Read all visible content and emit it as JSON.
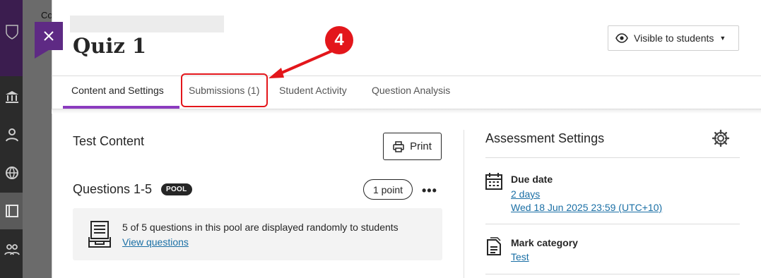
{
  "background_app": {
    "partial_text": "Co"
  },
  "panel": {
    "close_icon": "close-icon",
    "title": "Quiz 1",
    "visibility": {
      "label": "Visible to students",
      "icon": "eye-icon"
    }
  },
  "tabs": [
    {
      "label": "Content and Settings",
      "active": true
    },
    {
      "label": "Submissions (1)",
      "active": false
    },
    {
      "label": "Student Activity",
      "active": false
    },
    {
      "label": "Question Analysis",
      "active": false
    }
  ],
  "annotation": {
    "step_number": "4",
    "color": "#e3161b"
  },
  "test_content": {
    "title": "Test Content",
    "print_label": "Print",
    "questions_title": "Questions 1-5",
    "pool_badge": "POOL",
    "points": "1 point",
    "more_label": "•••",
    "pool_message": "5 of 5 questions in this pool are displayed randomly to students",
    "view_questions_link": "View questions"
  },
  "assessment_settings": {
    "title": "Assessment Settings",
    "due_date": {
      "label": "Due date",
      "relative": "2 days",
      "absolute": "Wed 18 Jun 2025 23:59 (UTC+10)"
    },
    "mark_category": {
      "label": "Mark category",
      "value": "Test"
    }
  },
  "colors": {
    "accent": "#8b3bbf",
    "brand_purple": "#5e2a84",
    "link": "#1a6fa5",
    "annotation_red": "#e3161b"
  }
}
